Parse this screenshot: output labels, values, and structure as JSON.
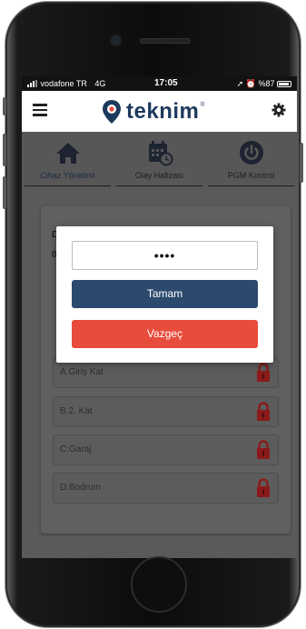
{
  "status_bar": {
    "carrier": "vodafone TR",
    "network": "4G",
    "time": "17:05",
    "battery": "%87"
  },
  "app_bar": {
    "logo_text": "teknim",
    "logo_mark": "®",
    "menu_icon": "hamburger-menu-icon",
    "settings_icon": "gear-icon"
  },
  "tabs": [
    {
      "label": "Cihaz Yönetimi",
      "icon": "home-icon",
      "active": true
    },
    {
      "label": "Olay Hafizası",
      "icon": "calendar-clock-icon",
      "active": false
    },
    {
      "label": "PGM Kontrol",
      "icon": "power-icon",
      "active": false
    }
  ],
  "card": {
    "partial_text_1": "D",
    "partial_text_2": "0",
    "zones": [
      {
        "label": "A.Giriş Kat",
        "icon": "lock-icon"
      },
      {
        "label": "B.2. Kat",
        "icon": "lock-icon"
      },
      {
        "label": "C.Garaj",
        "icon": "lock-icon"
      },
      {
        "label": "D.Bodrum",
        "icon": "lock-icon"
      }
    ]
  },
  "dialog": {
    "password_value": "••••",
    "ok_label": "Tamam",
    "cancel_label": "Vazgeç"
  },
  "colors": {
    "brand_navy": "#1e3a5c",
    "ok_button": "#2c4a6e",
    "cancel_button": "#e74c3c",
    "lock_red": "#8b1a1a"
  }
}
